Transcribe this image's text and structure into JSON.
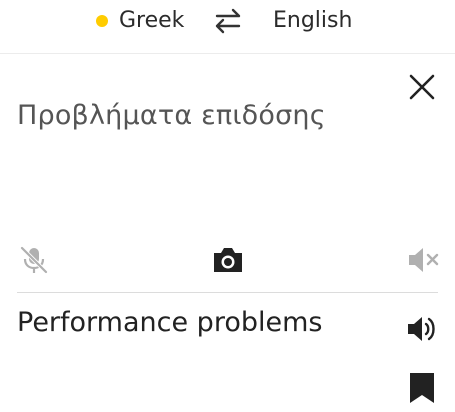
{
  "header": {
    "source_language": "Greek",
    "target_language": "English",
    "active_dot_color": "#FFCC00"
  },
  "source": {
    "text": "Προβλήματα επιδόσης"
  },
  "toolbar": {
    "mic_icon": "mic-off-icon",
    "camera_icon": "camera-icon",
    "mute_icon": "volume-mute-icon"
  },
  "translation": {
    "text": "Performance problems",
    "speaker_icon": "speaker-icon",
    "bookmark_icon": "bookmark-icon"
  },
  "colors": {
    "icon_dark": "#222222",
    "icon_muted": "#b0b0b0"
  }
}
